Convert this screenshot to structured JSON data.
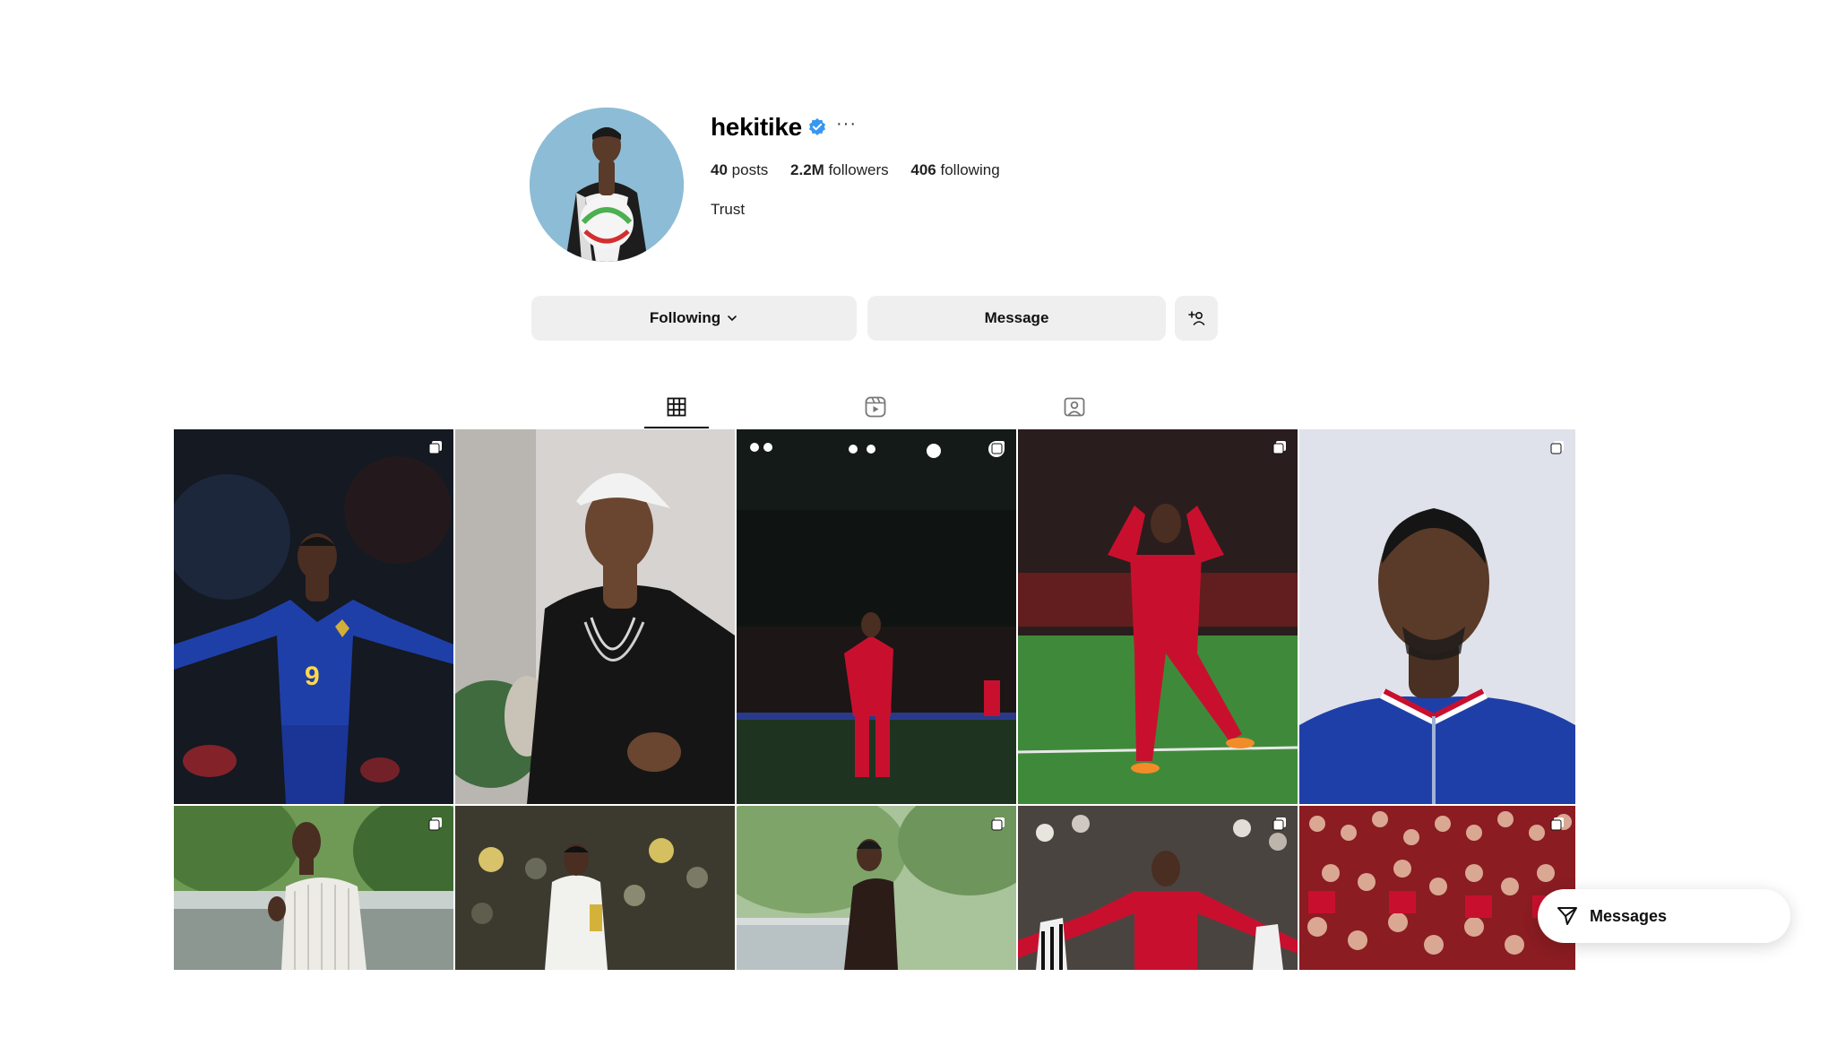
{
  "profile": {
    "username": "hekitike",
    "more_label": "···",
    "posts_count": "40",
    "posts_label": "posts",
    "followers_count": "2.2M",
    "followers_label": "followers",
    "following_count": "406",
    "following_label": "following",
    "bio": "Trust"
  },
  "actions": {
    "following_label": "Following",
    "message_label": "Message"
  },
  "tabs": [
    {
      "icon": "grid-icon",
      "active": true
    },
    {
      "icon": "reels-icon",
      "active": false
    },
    {
      "icon": "tagged-icon",
      "active": false
    }
  ],
  "posts": [
    {
      "subject": "France blue #9 kit celebration",
      "multi": true
    },
    {
      "subject": "white cap and black sweater with chains",
      "multi": false
    },
    {
      "subject": "Liverpool red kit at night stadium",
      "multi": true
    },
    {
      "subject": "Liverpool red kit arms raised",
      "multi": true
    },
    {
      "subject": "France blue jacket portrait",
      "multi": true
    },
    {
      "subject": "striped shirt outdoor",
      "multi": true
    },
    {
      "subject": "white kit in stadium",
      "multi": false
    },
    {
      "subject": "dark outfit in park",
      "multi": true
    },
    {
      "subject": "Liverpool red kit arms spread",
      "multi": true
    },
    {
      "subject": "crowd of fans in red",
      "multi": true
    }
  ],
  "messages_label": "Messages",
  "colors": {
    "verified": "#3897f0",
    "button_bg": "#efefef",
    "france_blue": "#1f3fa8",
    "liverpool_red": "#c8102e"
  }
}
